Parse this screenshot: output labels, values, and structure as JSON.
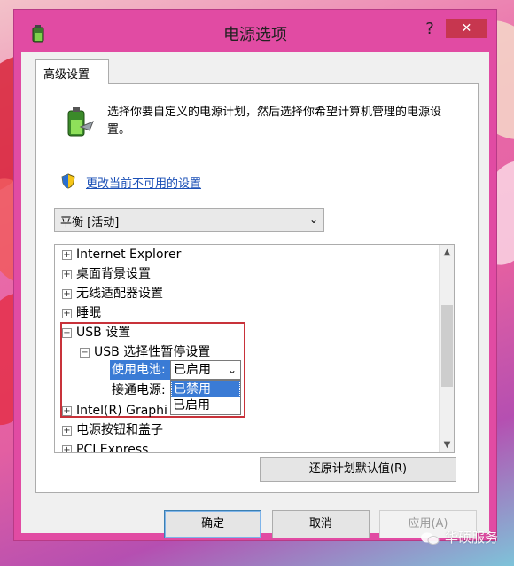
{
  "window": {
    "title": "电源选项",
    "help_label": "?",
    "close_label": "✕"
  },
  "tab": {
    "label": "高级设置"
  },
  "intro": {
    "text": "选择你要自定义的电源计划，然后选择你希望计算机管理的电源设置。"
  },
  "change_link": {
    "label": "更改当前不可用的设置"
  },
  "plan_select": {
    "value": "平衡 [活动]"
  },
  "tree": {
    "items": [
      {
        "label": "Internet Explorer",
        "toggle": "+"
      },
      {
        "label": "桌面背景设置",
        "toggle": "+"
      },
      {
        "label": "无线适配器设置",
        "toggle": "+"
      },
      {
        "label": "睡眠",
        "toggle": "+"
      },
      {
        "label": "USB 设置",
        "toggle": "−"
      },
      {
        "label": "USB 选择性暂停设置",
        "toggle": "−"
      },
      {
        "label": "Intel(R) Graphi",
        "toggle": "+"
      },
      {
        "label": "电源按钮和盖子",
        "toggle": "+"
      },
      {
        "label": "PCI Express",
        "toggle": "+"
      }
    ],
    "on_battery_label": "使用电池:",
    "on_battery_value": "已启用",
    "plugged_in_label": "接通电源:",
    "dropdown_options": [
      "已禁用",
      "已启用"
    ],
    "selected_option": "已禁用"
  },
  "buttons": {
    "restore": "还原计划默认值(R)",
    "ok": "确定",
    "cancel": "取消",
    "apply": "应用(A)"
  },
  "watermark": {
    "text": "华硕服务"
  },
  "colors": {
    "titlebar": "#e14ba3",
    "close": "#c7364f",
    "highlight": "#3a7bd5",
    "annotation_box": "#c8323a",
    "link": "#1a4fb6"
  }
}
